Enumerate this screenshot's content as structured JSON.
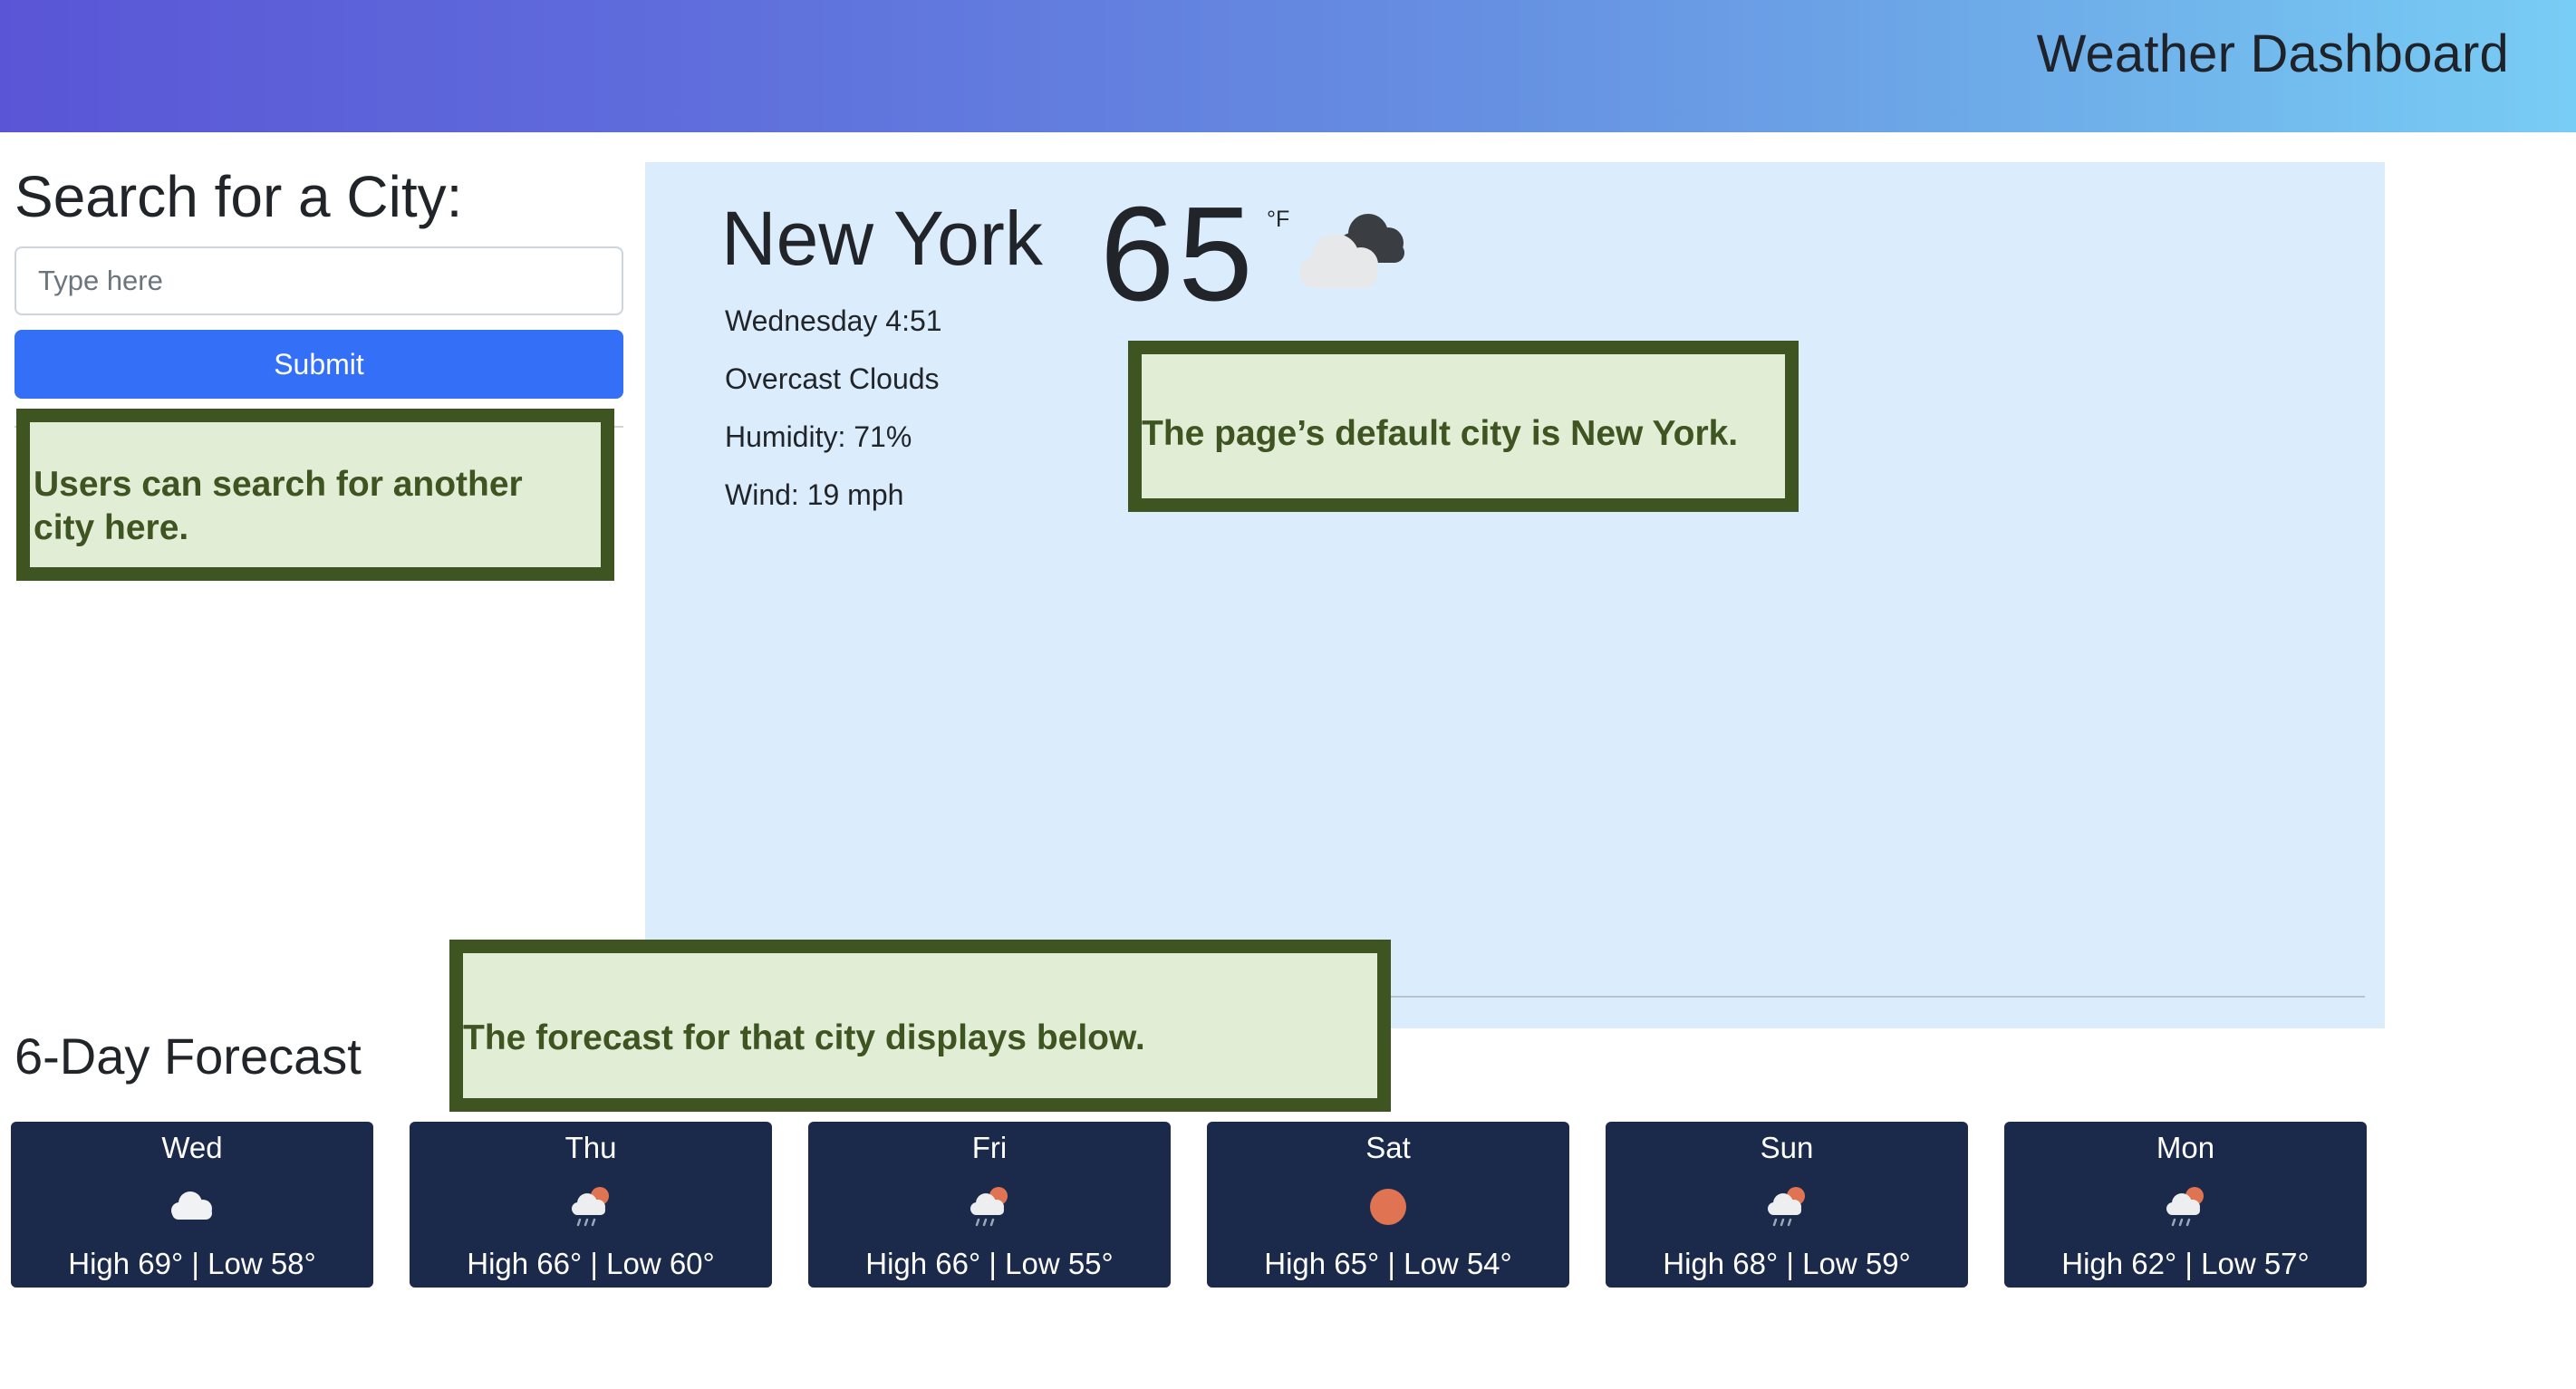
{
  "header": {
    "title": "Weather Dashboard"
  },
  "search": {
    "heading": "Search for a City:",
    "placeholder": "Type here",
    "value": "",
    "submit_label": "Submit"
  },
  "current": {
    "city": "New York",
    "temperature": "65",
    "unit": "°F",
    "icon": "cloud-icon",
    "datetime": "Wednesday 4:51",
    "description": "Overcast Clouds",
    "humidity": "Humidity: 71%",
    "wind": "Wind: 19 mph"
  },
  "forecast": {
    "heading": "6-Day Forecast",
    "days": [
      {
        "day": "Wed",
        "icon": "cloud-icon",
        "temps": "High 69° | Low 58°"
      },
      {
        "day": "Thu",
        "icon": "rain-sun-icon",
        "temps": "High 66° | Low 60°"
      },
      {
        "day": "Fri",
        "icon": "rain-sun-icon",
        "temps": "High 66° | Low 55°"
      },
      {
        "day": "Sat",
        "icon": "sun-icon",
        "temps": "High 65° | Low 54°"
      },
      {
        "day": "Sun",
        "icon": "rain-sun-icon",
        "temps": "High 68° | Low 59°"
      },
      {
        "day": "Mon",
        "icon": "rain-sun-icon",
        "temps": "High 62° | Low 57°"
      }
    ]
  },
  "annotations": {
    "search_note": "Users can search for another city here.",
    "default_city_note": "The page’s default city is New York.",
    "forecast_note": "The forecast for that city displays below."
  },
  "colors": {
    "accent_button": "#3370f7",
    "forecast_card": "#1b2a4b",
    "current_panel": "#dbecfc",
    "note_border": "#3e5421",
    "note_fill": "#e1edd5",
    "sun": "#e07352"
  }
}
